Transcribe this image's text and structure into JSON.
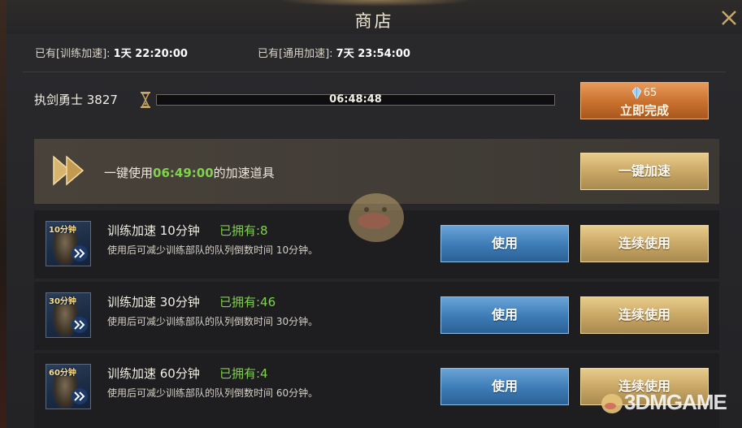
{
  "header": {
    "title": "商店"
  },
  "timers": {
    "training": {
      "label": "已有[训练加速]:",
      "value": "1天 22:20:00"
    },
    "general": {
      "label": "已有[通用加速]:",
      "value": "7天 23:54:00"
    }
  },
  "queue": {
    "unit_label": "执剑勇士 3827",
    "remaining_time": "06:48:48",
    "progress_fraction": 0.0,
    "finish_cost": "65",
    "finish_label": "立即完成"
  },
  "one_key": {
    "prefix": "一键使用",
    "time": "06:49:00",
    "suffix": "的加速道具",
    "button": "一键加速"
  },
  "items": [
    {
      "icon_label": "10分钟",
      "name": "训练加速 10分钟",
      "owned": "已拥有:8",
      "desc": "使用后可减少训练部队的队列倒数时间 10分钟。",
      "use": "使用",
      "use_multi": "连续使用"
    },
    {
      "icon_label": "30分钟",
      "name": "训练加速 30分钟",
      "owned": "已拥有:46",
      "desc": "使用后可减少训练部队的队列倒数时间 30分钟。",
      "use": "使用",
      "use_multi": "连续使用"
    },
    {
      "icon_label": "60分钟",
      "name": "训练加速 60分钟",
      "owned": "已拥有:4",
      "desc": "使用后可减少训练部队的队列倒数时间 60分钟。",
      "use": "使用",
      "use_multi": "连续使用"
    }
  ],
  "watermark": "3DMGAME",
  "colors": {
    "accent_green": "#7fd24b",
    "finish_orange": "#c8702e",
    "gold": "#caa866",
    "blue": "#3f7eb8"
  }
}
